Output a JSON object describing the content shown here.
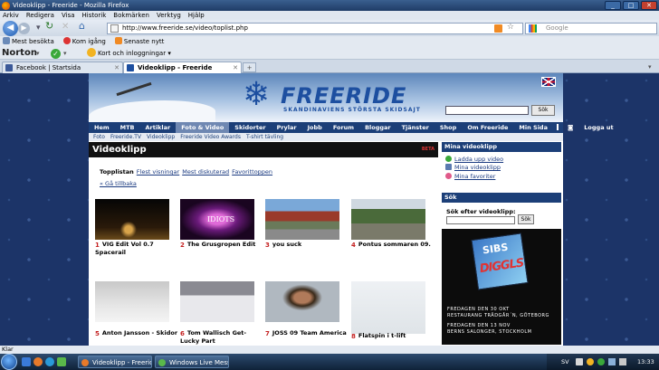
{
  "window": {
    "title": "Videoklipp - Freeride - Mozilla Firefox",
    "btn_min": "_",
    "btn_max": "□",
    "btn_close": "✕"
  },
  "menu": [
    "Arkiv",
    "Redigera",
    "Visa",
    "Historik",
    "Bokmärken",
    "Verktyg",
    "Hjälp"
  ],
  "nav": {
    "back_glyph": "◀",
    "fwd_glyph": "▶",
    "url": "http://www.freeride.se/video/toplist.php",
    "search_placeholder": "Google"
  },
  "bookmarks": [
    "Mest besökta",
    "Kom igång",
    "Senaste nytt"
  ],
  "norton": {
    "brand": "Norton",
    "check": "✓",
    "kort": "Kort och inloggningar"
  },
  "tabs": [
    {
      "label": "Facebook | Startsida",
      "color": "#3b5998"
    },
    {
      "label": "Videoklipp - Freeride",
      "color": "#1d4fa0"
    }
  ],
  "site": {
    "logo_glyph": "❄",
    "logo_text": "FREERIDE",
    "logo_tag": "SKANDINAVIENS STÖRSTA SKIDSAJT",
    "search_button": "Sök",
    "mainnav": [
      "Hem",
      "MTB",
      "Artiklar",
      "Foto & Video",
      "Skidorter",
      "Prylar",
      "Jobb",
      "Forum",
      "Bloggar",
      "Tjänster",
      "Shop",
      "Om Freeride",
      "Min Sida",
      "",
      "Logga ut"
    ],
    "active_nav": 3,
    "subnav": [
      "Foto",
      "Freeride.TV",
      "Videoklipp",
      "Freeride Video Awards",
      "T-shirt tävling"
    ],
    "page_title": "Videoklipp",
    "beta": "BETA",
    "content_tabs": {
      "current": "Topplistan",
      "others": [
        "Flest visningar",
        "Mest diskuterad",
        "Favorittoppen"
      ]
    },
    "back_link": "« Gå tillbaka",
    "videos": [
      {
        "num": "1",
        "title": "VIG Edit Vol 0.7 Spacerail",
        "thumb": "night"
      },
      {
        "num": "2",
        "title": "The Grusgropen Edit",
        "thumb": "idiots",
        "thumb_text": "IDIOTS"
      },
      {
        "num": "3",
        "title": "you suck",
        "thumb": "fisheye"
      },
      {
        "num": "4",
        "title": "Pontus sommaren 09.",
        "thumb": "bmx"
      },
      {
        "num": "5",
        "title": "Anton Jansson - Skidor",
        "thumb": "snowfog"
      },
      {
        "num": "6",
        "title": "Tom Wallisch Get-Lucky Part",
        "thumb": "rail"
      },
      {
        "num": "7",
        "title": "JOSS 09 Team America",
        "thumb": "face"
      },
      {
        "num": "8",
        "title": "Flatspin i t-lift",
        "thumb": "slope"
      }
    ],
    "sidebar": {
      "head_videos": "Mina videoklipp",
      "links": [
        "Ladda upp video",
        "Mina videoklipp",
        "Mina favoriter"
      ],
      "head_search": "Sök",
      "search_label": "Sök efter videoklipp:",
      "search_button": "Sök",
      "ad": {
        "poster_small": "SIBS",
        "poster_big": "DIGGLS",
        "line1": "FREDAGEN DEN 30 OKT",
        "line2": "RESTAURANG TRÄDGÅR´N, GÖTEBORG",
        "line3": "FREDAGEN DEN 13 NOV",
        "line4": "BERNS SALONGER, STOCKHOLM"
      }
    }
  },
  "status": "Klar",
  "taskbar": {
    "tasks": [
      "Videoklipp - Freerid...",
      "Windows Live Mess..."
    ],
    "lang": "SV",
    "clock": "13:33"
  },
  "colors": {
    "nav_blue": "#1c3f78",
    "accent_red": "#c42020",
    "link": "#1a3a80"
  }
}
